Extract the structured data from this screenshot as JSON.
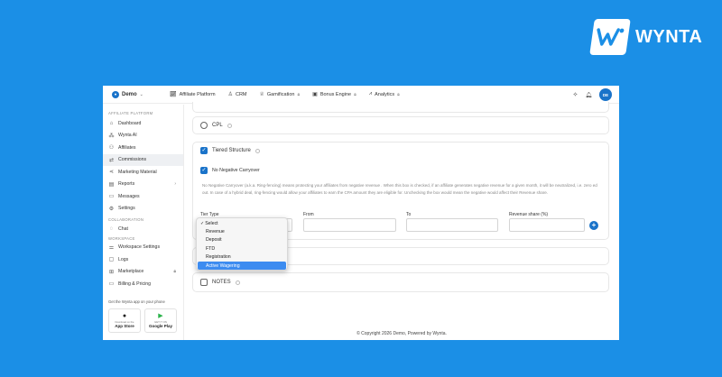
{
  "brand": {
    "name": "WYNTA"
  },
  "topbar": {
    "org": "Demo",
    "nav": [
      {
        "label": "Affiliate Platform",
        "icon": "chart-icon",
        "locked": false
      },
      {
        "label": "CRM",
        "icon": "user-icon",
        "locked": false
      },
      {
        "label": "Gamification",
        "icon": "trophy-icon",
        "locked": true
      },
      {
        "label": "Bonus Engine",
        "icon": "gift-icon",
        "locked": true
      },
      {
        "label": "Analytics",
        "icon": "analytics-icon",
        "locked": true
      }
    ],
    "avatar": "DE"
  },
  "sidebar": {
    "section_affiliate": "AFFILIATE PLATFORM",
    "items": [
      {
        "label": "Dashboard"
      },
      {
        "label": "Wynta AI"
      },
      {
        "label": "Affiliates"
      },
      {
        "label": "Commissions",
        "active": true
      },
      {
        "label": "Marketing Material"
      },
      {
        "label": "Reports"
      },
      {
        "label": "Messages"
      },
      {
        "label": "Settings"
      }
    ],
    "section_collab": "COLLABORATION",
    "chat": "Chat",
    "section_workspace": "WORKSPACE",
    "workspace_items": [
      {
        "label": "Workspace Settings"
      },
      {
        "label": "Logs"
      },
      {
        "label": "Marketplace"
      },
      {
        "label": "Billing & Pricing"
      }
    ],
    "app_promo": "Get the Wynta app on your phone",
    "appstore_sub": "Download on the",
    "appstore": "App Store",
    "googleplay_sub": "GET IT ON",
    "googleplay": "Google Play"
  },
  "main": {
    "cpl_label": "CPL",
    "tiered_label": "Tiered Structure",
    "no_carryover_label": "No Negative Carryover",
    "description": "No Negative Carryover (a.k.a. Ring-fencing) means protecting your affiliates from negative revenue . When this box is checked, if an affiliate generates negative revenue for a given month, it will be neutralized, i.e. zero ed out. In case of a hybrid deal, ring-fencing would allow your affiliates to earn the CPA amount they are eligible for. Unchecking the box would mean the negative would affect their Revenue share.",
    "tier_type_label": "Tier Type",
    "from_label": "From",
    "to_label": "To",
    "revenue_share_label": "Revenue share (%)",
    "notes_label": "NOTES",
    "dropdown_options": [
      "Select",
      "Revenue",
      "Deposit",
      "FTD",
      "Registration",
      "Active Wagering"
    ]
  },
  "footer": {
    "text": "© Copyright 2026 Demo, Powered by Wynta."
  }
}
